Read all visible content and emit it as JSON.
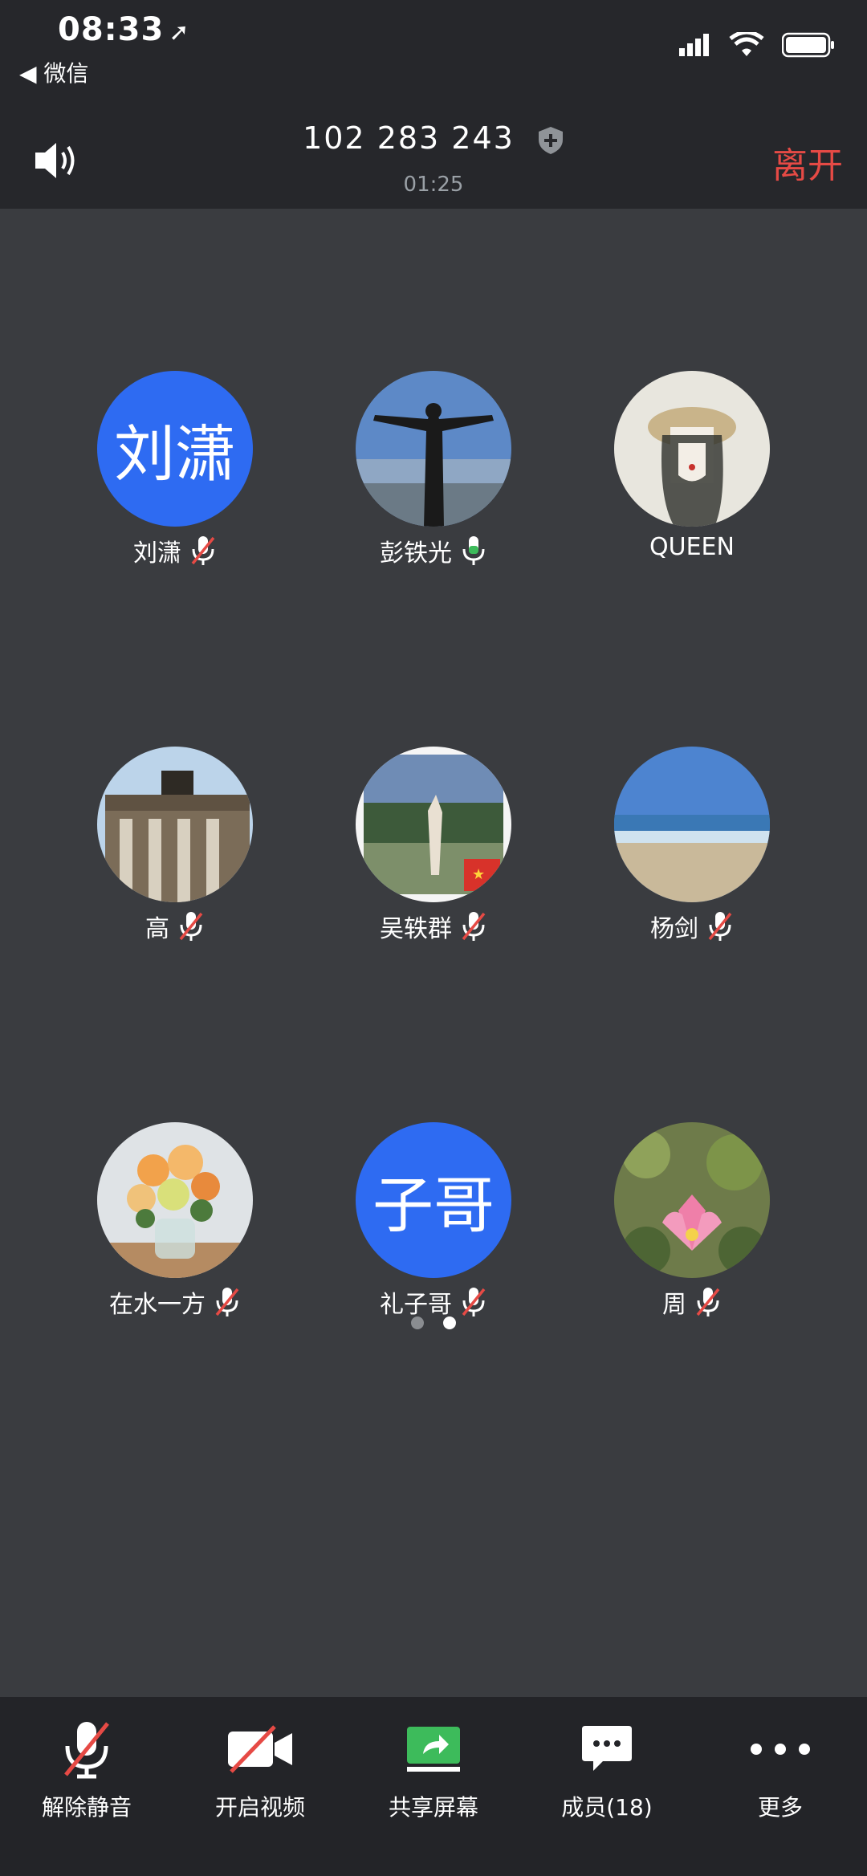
{
  "status_bar": {
    "time": "08:33",
    "back_app": "◀ 微信"
  },
  "header": {
    "meeting_id": "102 283 243",
    "timer": "01:25",
    "leave_label": "离开"
  },
  "participants": [
    {
      "name": "刘潇",
      "avatar_text": "刘潇",
      "mic": "muted"
    },
    {
      "name": "彭铁光",
      "avatar_text": "",
      "mic": "on"
    },
    {
      "name": "QUEEN",
      "avatar_text": "",
      "mic": "none"
    },
    {
      "name": "高",
      "avatar_text": "",
      "mic": "muted"
    },
    {
      "name": "吴轶群",
      "avatar_text": "",
      "mic": "muted"
    },
    {
      "name": "杨剑",
      "avatar_text": "",
      "mic": "muted"
    },
    {
      "name": "在水一方",
      "avatar_text": "",
      "mic": "muted"
    },
    {
      "name": "礼子哥",
      "avatar_text": "子哥",
      "mic": "muted"
    },
    {
      "name": "周",
      "avatar_text": "",
      "mic": "muted"
    }
  ],
  "toolbar": {
    "unmute": "解除静音",
    "start_video": "开启视频",
    "share_screen": "共享屏幕",
    "members": "成员(18)",
    "more": "更多"
  },
  "colors": {
    "avatar_blue": "#2e6bf2",
    "leave_red": "#e64a45",
    "share_green": "#3dbb5b"
  }
}
